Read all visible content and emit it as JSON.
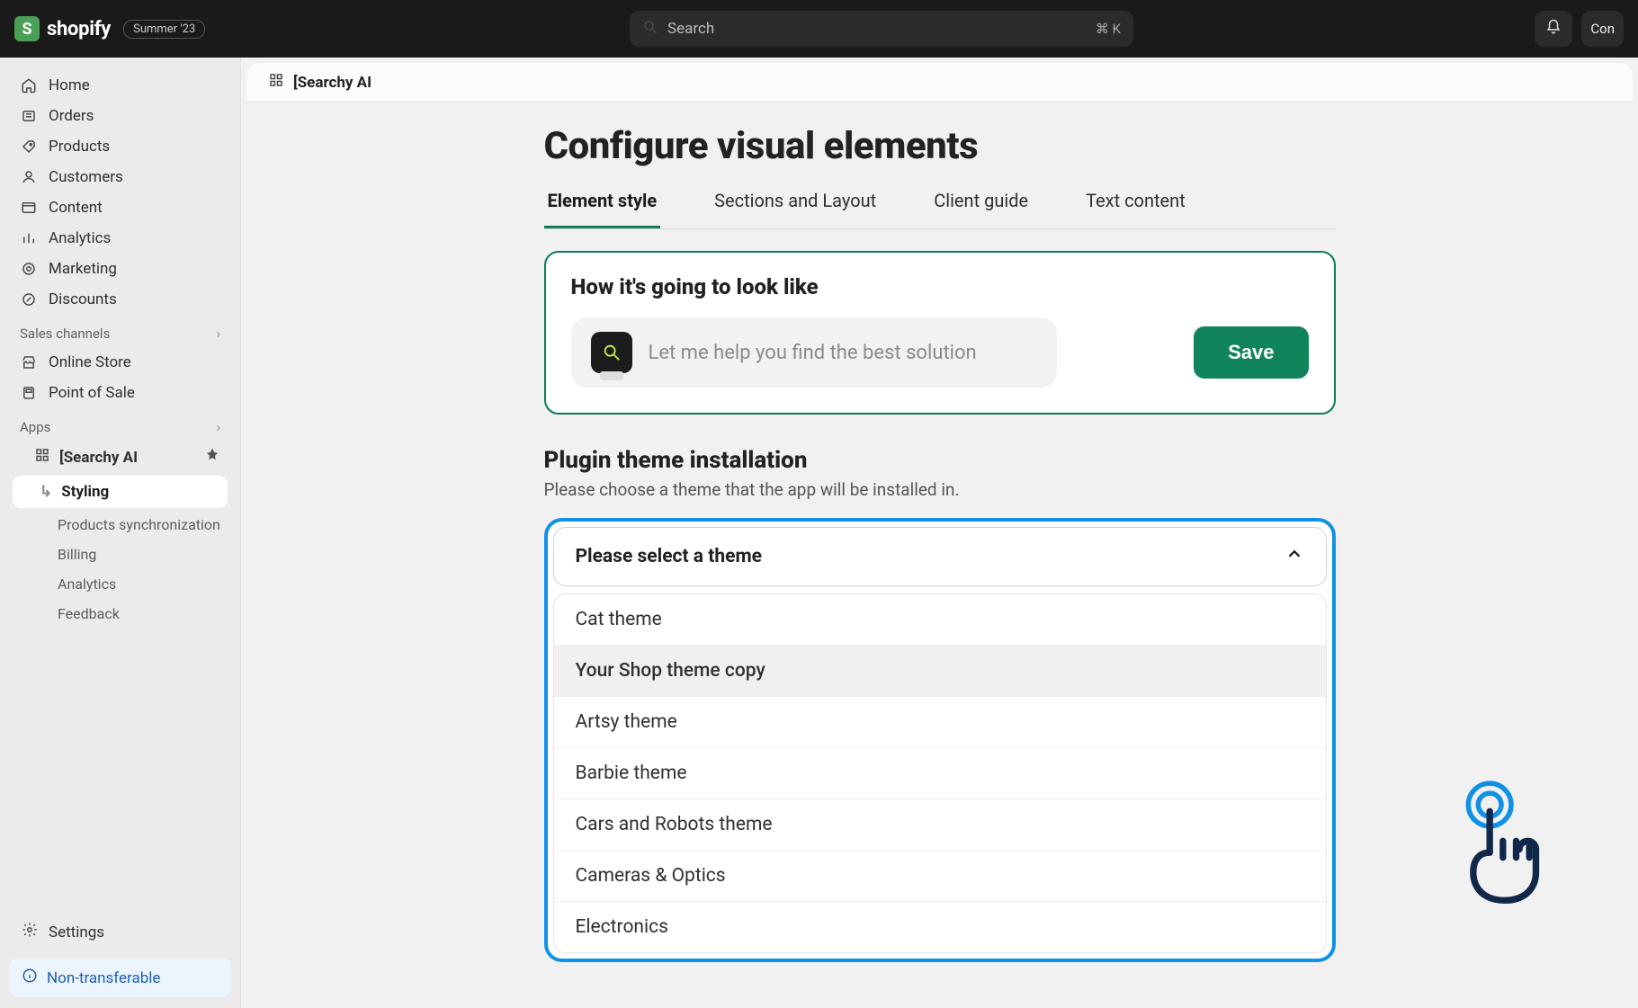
{
  "topbar": {
    "brand": "shopify",
    "badge": "Summer '23",
    "search_placeholder": "Search",
    "search_shortcut": "⌘ K",
    "user_label": "Con"
  },
  "sidebar": {
    "nav": [
      {
        "icon": "home",
        "label": "Home"
      },
      {
        "icon": "orders",
        "label": "Orders"
      },
      {
        "icon": "products",
        "label": "Products"
      },
      {
        "icon": "customers",
        "label": "Customers"
      },
      {
        "icon": "content",
        "label": "Content"
      },
      {
        "icon": "analytics",
        "label": "Analytics"
      },
      {
        "icon": "marketing",
        "label": "Marketing"
      },
      {
        "icon": "discounts",
        "label": "Discounts"
      }
    ],
    "sections": {
      "sales_channels_label": "Sales channels",
      "apps_label": "Apps"
    },
    "channels": [
      {
        "label": "Online Store"
      },
      {
        "label": "Point of Sale"
      }
    ],
    "app_entry": "[Searchy AI",
    "app_subnav": [
      "Styling",
      "Products synchronization",
      "Billing",
      "Analytics",
      "Feedback"
    ],
    "settings_label": "Settings",
    "footer_chip": "Non-transferable"
  },
  "breadcrumb": {
    "app_name": "[Searchy AI"
  },
  "main": {
    "title": "Configure visual elements",
    "tabs": [
      "Element style",
      "Sections and Layout",
      "Client guide",
      "Text content"
    ],
    "preview": {
      "heading": "How it's going to look like",
      "placeholder": "Let me help you find the best solution",
      "save_label": "Save"
    },
    "theme_section": {
      "title": "Plugin theme installation",
      "desc": "Please choose a theme that the app will be installed in.",
      "select_placeholder": "Please select a theme",
      "selected_index": 1,
      "options": [
        "Cat theme",
        "Your Shop theme copy",
        "Artsy theme",
        "Barbie theme",
        "Cars and Robots theme",
        "Cameras & Optics",
        "Electronics"
      ]
    }
  }
}
